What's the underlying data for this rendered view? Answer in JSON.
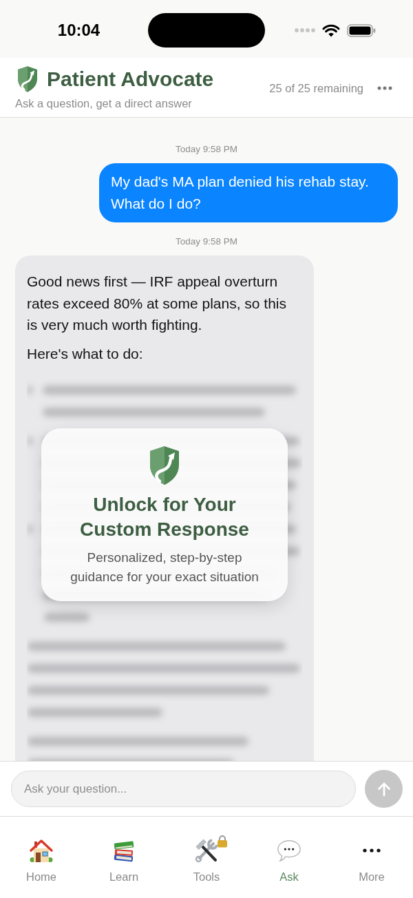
{
  "status_bar": {
    "time": "10:04"
  },
  "header": {
    "title": "Patient Advocate",
    "subtitle": "Ask a question, get a direct answer",
    "remaining": "25 of 25 remaining"
  },
  "messages": [
    {
      "kind": "user",
      "timestamp": "Today 9:58 PM",
      "paragraphs": [
        "My dad's MA plan denied his rehab stay. What do I do?"
      ]
    },
    {
      "kind": "assistant",
      "timestamp": "Today 9:58 PM",
      "paragraphs": [
        "Good news first — IRF appeal overturn rates exceed 80% at some plans, so this is very much worth fighting.",
        "Here's what to do:"
      ],
      "locked": true,
      "unlock_card": {
        "title": "Unlock for Your Custom Response",
        "description": "Personalized, step-by-step guidance for your exact situation"
      }
    }
  ],
  "composer": {
    "placeholder": "Ask your question...",
    "send_disabled": true
  },
  "tabs": [
    {
      "label": "Home",
      "selected": false,
      "locked": false
    },
    {
      "label": "Learn",
      "selected": false,
      "locked": false
    },
    {
      "label": "Tools",
      "selected": false,
      "locked": true
    },
    {
      "label": "Ask",
      "selected": true,
      "locked": false
    },
    {
      "label": "More",
      "selected": false,
      "locked": false
    }
  ]
}
